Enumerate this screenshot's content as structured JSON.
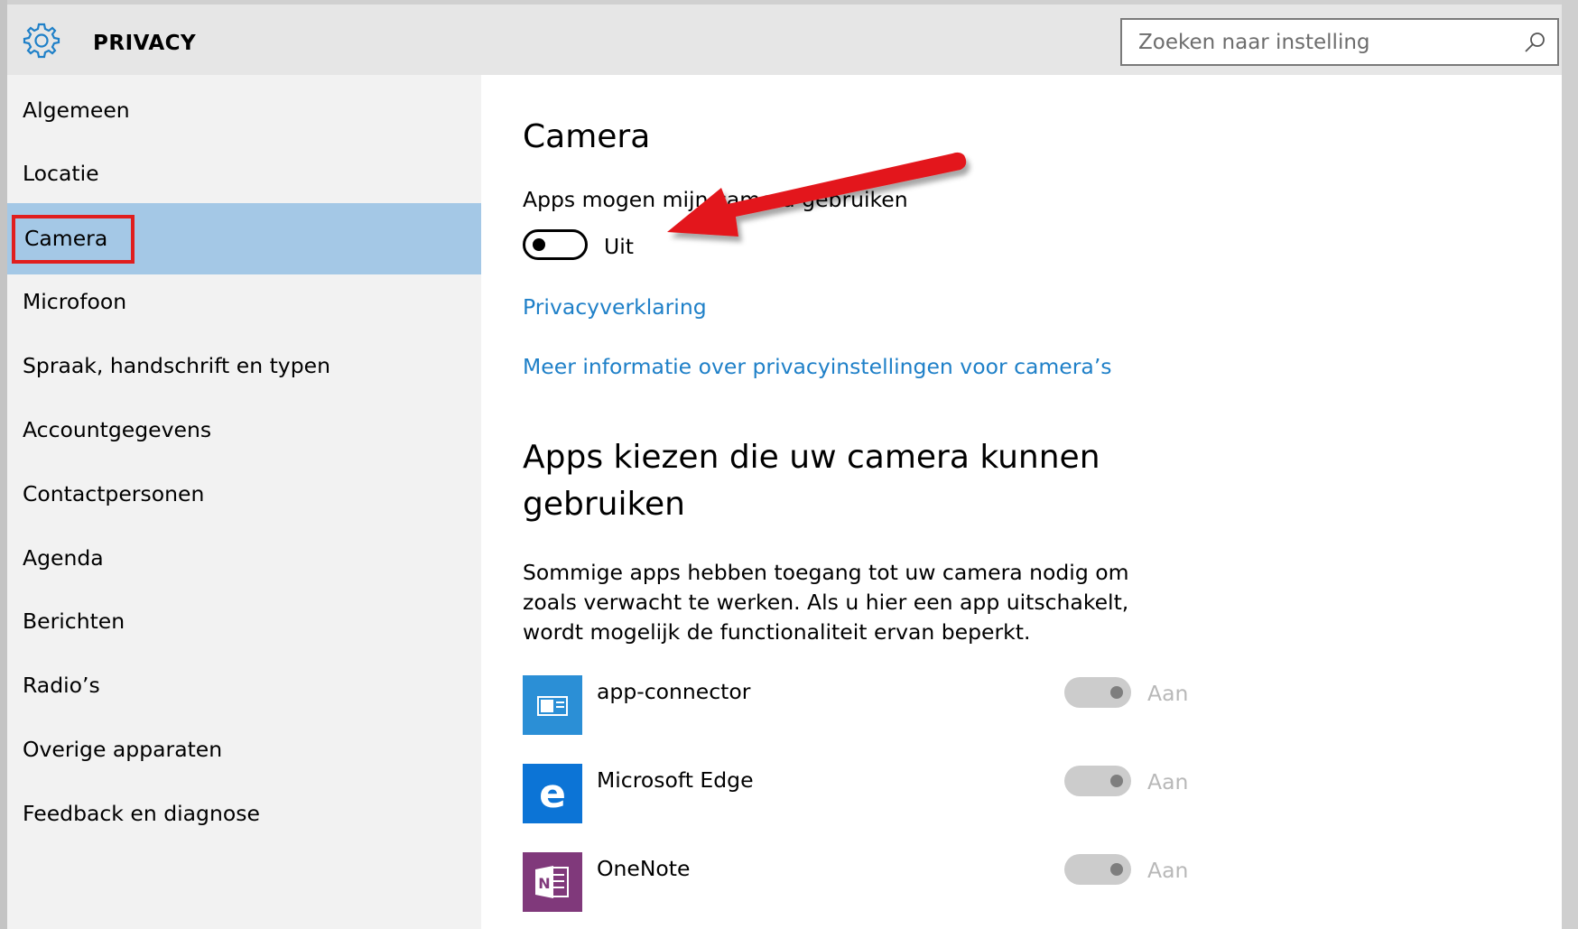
{
  "header": {
    "title": "PRIVACY",
    "search_placeholder": "Zoeken naar instelling"
  },
  "sidebar": {
    "items": [
      {
        "label": "Algemeen"
      },
      {
        "label": "Locatie"
      },
      {
        "label": "Camera",
        "selected": true
      },
      {
        "label": "Microfoon"
      },
      {
        "label": "Spraak, handschrift en typen"
      },
      {
        "label": "Accountgegevens"
      },
      {
        "label": "Contactpersonen"
      },
      {
        "label": "Agenda"
      },
      {
        "label": "Berichten"
      },
      {
        "label": "Radio’s"
      },
      {
        "label": "Overige apparaten"
      },
      {
        "label": "Feedback en diagnose"
      }
    ]
  },
  "main": {
    "title": "Camera",
    "apps_allowed_label": "Apps mogen mijn camera gebruiken",
    "apps_allowed_state": "Uit",
    "apps_allowed_on": false,
    "link_privacy": "Privacyverklaring",
    "link_more": "Meer informatie over privacyinstellingen voor camera’s",
    "choose_heading": "Apps kiezen die uw camera kunnen gebruiken",
    "description": "Sommige apps hebben toegang tot uw camera nodig om zoals verwacht te werken. Als u hier een app uitschakelt, wordt mogelijk de functionaliteit ervan beperkt.",
    "apps": [
      {
        "name": "app-connector",
        "state": "Aan",
        "icon": "app-connector-icon",
        "color": "#2b8fd6"
      },
      {
        "name": "Microsoft Edge",
        "state": "Aan",
        "icon": "edge-icon",
        "color": "#0c74d6"
      },
      {
        "name": "OneNote",
        "state": "Aan",
        "icon": "onenote-icon",
        "color": "#80397b"
      }
    ]
  },
  "colors": {
    "header_bg": "#e6e6e6",
    "sidebar_bg": "#f2f2f2",
    "selected_bg": "#a4c8e6",
    "highlight_red": "#e01e1e",
    "link": "#1f80c8",
    "annotation_arrow": "#e3191b"
  }
}
